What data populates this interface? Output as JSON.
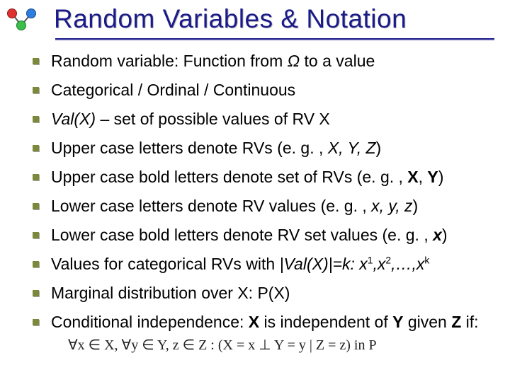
{
  "title": "Random Variables & Notation",
  "icons": {
    "logo": "graph-nodes-logo"
  },
  "bullets": {
    "b0": {
      "pre": "Random variable: Function from ",
      "omega": "Ω",
      "post": " to a value"
    },
    "b1": {
      "text": "Categorical / Ordinal / Continuous"
    },
    "b2": {
      "val": "Val(X)",
      "post": " – set of possible values of RV X"
    },
    "b3": {
      "pre": "Upper case letters denote RVs (e. g. , ",
      "vars": "X, Y, Z",
      "post": ")"
    },
    "b4": {
      "pre": "Upper case bold letters denote set of RVs (e. g. , ",
      "v1": "X",
      "sep": ", ",
      "v2": "Y",
      "post": ")"
    },
    "b5": {
      "pre": "Lower case letters denote RV values (e. g. , ",
      "vars": "x, y, z",
      "post": ")"
    },
    "b6": {
      "pre": "Lower case bold letters denote RV set values (e. g. , ",
      "v": "x",
      "post": ")"
    },
    "b7": {
      "pre": "Values for categorical RVs with ",
      "mid": "|Val(X)|=k: x",
      "s1": "1",
      "c1": ",x",
      "s2": "2",
      "c2": ",…,x",
      "s3": "k"
    },
    "b8": {
      "text": "Marginal distribution over X: P(X)"
    },
    "b9": {
      "pre": "Conditional independence: ",
      "x": "X",
      "mid1": " is independent of ",
      "y": "Y",
      "mid2": " given ",
      "z": "Z",
      "post": " if:"
    },
    "formula": "∀x ∈ X, ∀y ∈ Y, z ∈ Z : (X = x ⊥ Y = y | Z = z) in P"
  }
}
